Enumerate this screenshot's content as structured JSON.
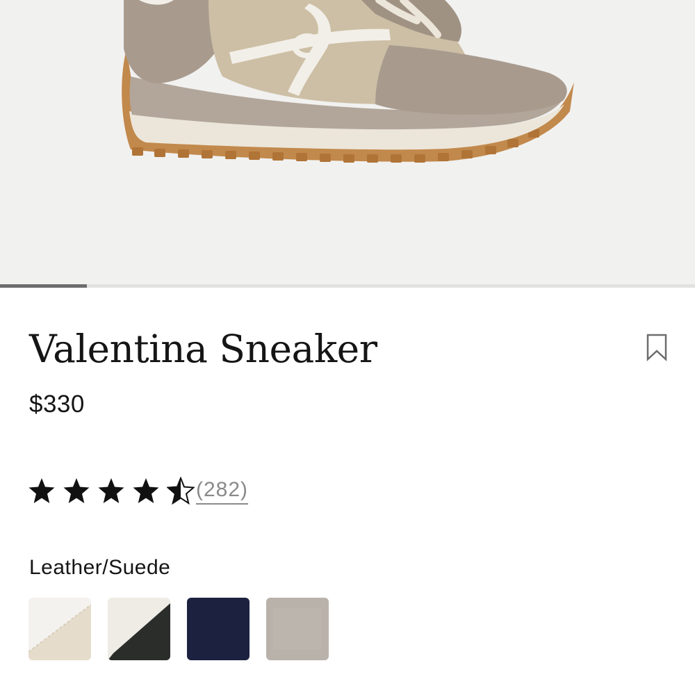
{
  "product": {
    "name": "Valentina Sneaker",
    "price": "$330",
    "rating": {
      "value": 4.5,
      "max": 5,
      "review_count_label": "(282)"
    },
    "material_label": "Leather/Suede",
    "swatches": [
      {
        "name": "white-cream",
        "colors": [
          "#f4f2ee",
          "#e6dccb"
        ]
      },
      {
        "name": "white-black",
        "colors": [
          "#efece6",
          "#2b2d2b"
        ]
      },
      {
        "name": "navy",
        "colors": [
          "#1c2140"
        ]
      },
      {
        "name": "taupe",
        "colors": [
          "#b9b2ab"
        ]
      }
    ]
  },
  "carousel": {
    "current_slide_fraction": 0.125
  },
  "icons": {
    "save": "bookmark-icon",
    "star": "star-icon",
    "half_star": "half-star-icon"
  },
  "colors": {
    "hero_bg": "#f1f1f0",
    "text": "#151515",
    "muted": "#8a8a8a",
    "progress": "#6d6d6d"
  }
}
